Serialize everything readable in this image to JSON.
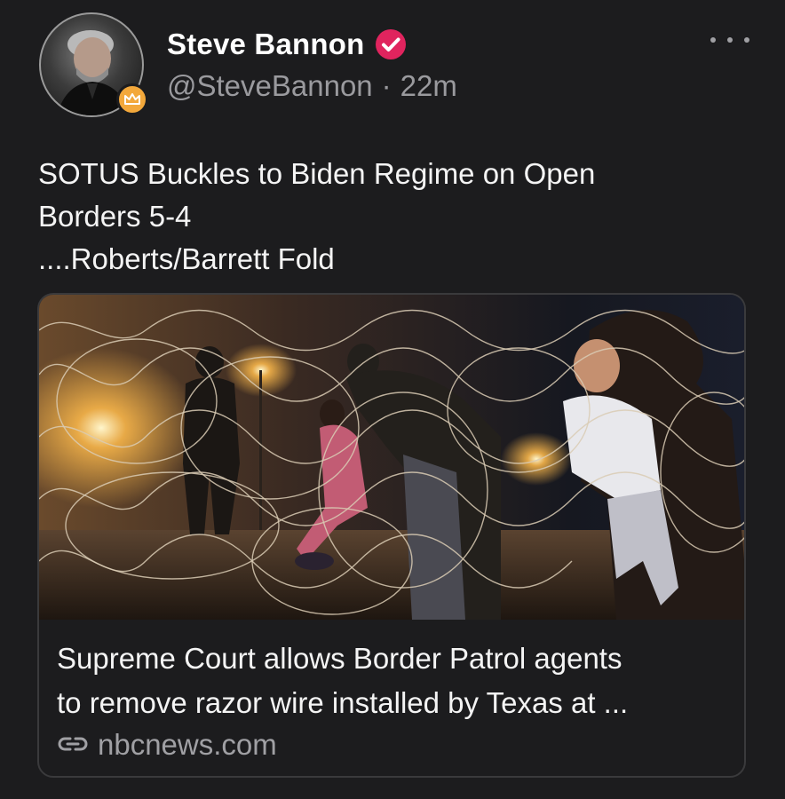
{
  "author": {
    "display_name": "Steve Bannon",
    "handle": "@SteveBannon",
    "separator": "·",
    "time_ago": "22m",
    "verified_color": "#e0245e",
    "badge_color": "#f3a83b"
  },
  "post": {
    "text_lines": [
      "SOTUS Buckles to Biden Regime on Open",
      "Borders 5-4",
      "....Roberts/Barrett Fold"
    ]
  },
  "link_card": {
    "title_lines": [
      "Supreme Court allows Border Patrol agents",
      "to remove razor wire installed by Texas at ..."
    ],
    "source": "nbcnews.com",
    "image_icon": "photo-razor-wire-border-night"
  },
  "icons": {
    "verified": "verified-check-icon",
    "badge": "crown-badge-icon",
    "more": "more-dots-icon",
    "link": "link-icon"
  },
  "theme": {
    "background": "#1c1c1e",
    "text": "#f4f4f4",
    "muted": "#9a9a9e",
    "card_border": "#3a3a3c"
  }
}
